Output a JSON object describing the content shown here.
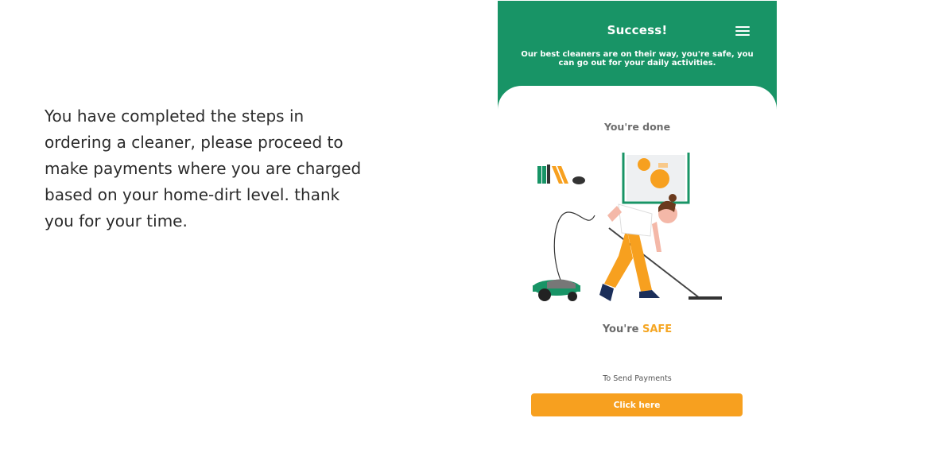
{
  "intro": {
    "text": "You have completed the steps in ordering a cleaner, please proceed to make payments where you are charged based on your home-dirt level. thank you for your time."
  },
  "phone": {
    "header": {
      "title": "Success!",
      "subtitle": "Our best cleaners are on their way, you're safe, you can go out for your daily activities.",
      "menu_icon": "hamburger-menu-icon"
    },
    "done_label": "You're done",
    "illustration": "woman-vacuuming-illustration",
    "safe": {
      "prefix": "You're",
      "highlight": "SAFE"
    },
    "payment": {
      "label": "To Send Payments",
      "button_label": "Click here"
    }
  },
  "colors": {
    "header_green": "#189466",
    "accent_orange": "#f7a01f",
    "highlight_orange": "#f5a623",
    "text_dark": "#2b2b2b"
  }
}
